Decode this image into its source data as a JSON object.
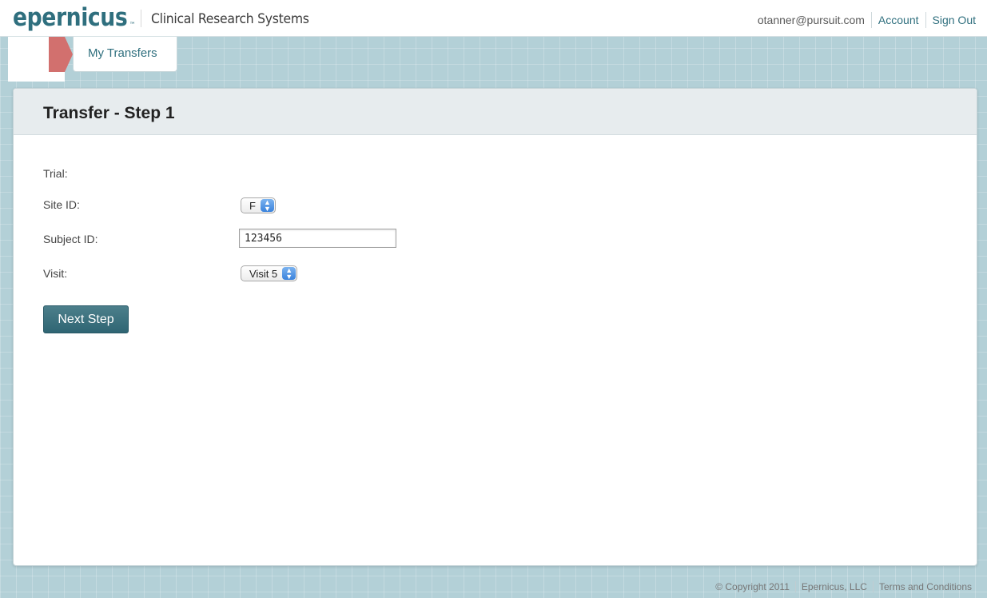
{
  "header": {
    "logo": "epernicus",
    "logo_tm": "™",
    "app_title": "Clinical Research Systems",
    "user_email": "otanner@pursuit.com",
    "account_link": "Account",
    "sign_out_link": "Sign Out"
  },
  "tabs": {
    "my_transfers": "My Transfers"
  },
  "form": {
    "title": "Transfer - Step 1",
    "trial_label": "Trial:",
    "site_label": "Site ID:",
    "site_value": "F",
    "subject_label": "Subject ID:",
    "subject_value": "123456",
    "visit_label": "Visit:",
    "visit_value": "Visit 5",
    "next_button": "Next Step"
  },
  "footer": {
    "copyright": "© Copyright 2011",
    "company_link": "Epernicus, LLC",
    "terms_link": "Terms and Conditions"
  },
  "icons": {
    "select_arrows": "up-down-chevron-icon"
  },
  "colors": {
    "brand": "#2f6f7e",
    "background": "#b3d0d7",
    "tab_accent": "#d2706e",
    "button": "#2f6573"
  }
}
